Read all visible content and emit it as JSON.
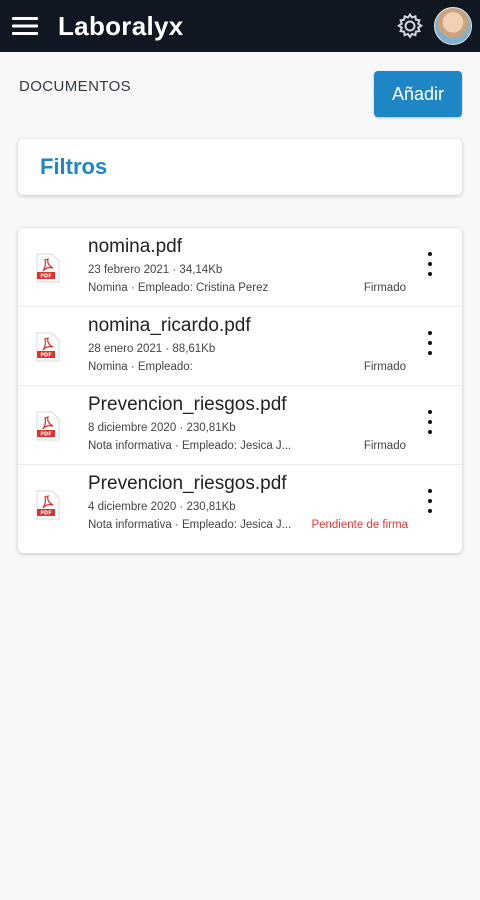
{
  "app": {
    "title": "Laboralyx",
    "menu_icon": "hamburger-icon",
    "settings_icon": "gear-icon",
    "avatar": "user-avatar"
  },
  "header": {
    "section_label": "DOCUMENTOS",
    "add_button": "Añadir"
  },
  "filters": {
    "title": "Filtros"
  },
  "colors": {
    "topbar": "#0f1722",
    "accent": "#1f86c6",
    "pending": "#e53935",
    "pdf_red": "#e0312a"
  },
  "documents": [
    {
      "name": "nomina.pdf",
      "meta": "23 febrero 2021 · 34,14Kb",
      "info": "Nomina · Empleado: Cristina Perez",
      "status": "Firmado",
      "icon": "pdf-file-icon"
    },
    {
      "name": "nomina_ricardo.pdf",
      "meta": "28 enero 2021 · 88,61Kb",
      "info": "Nomina · Empleado:",
      "status": "Firmado",
      "icon": "pdf-file-icon"
    },
    {
      "name": "Prevencion_riesgos.pdf",
      "meta": "8 diciembre 2020 · 230,81Kb",
      "info": "Nota informativa · Empleado: Jesica J...",
      "status": "Firmado",
      "icon": "pdf-file-icon"
    },
    {
      "name": "Prevencion_riesgos.pdf",
      "meta": "4 diciembre 2020 · 230,81Kb",
      "info": "Nota informativa · Empleado: Jesica J...",
      "status": "Pendiente de firma",
      "icon": "pdf-file-icon"
    }
  ]
}
